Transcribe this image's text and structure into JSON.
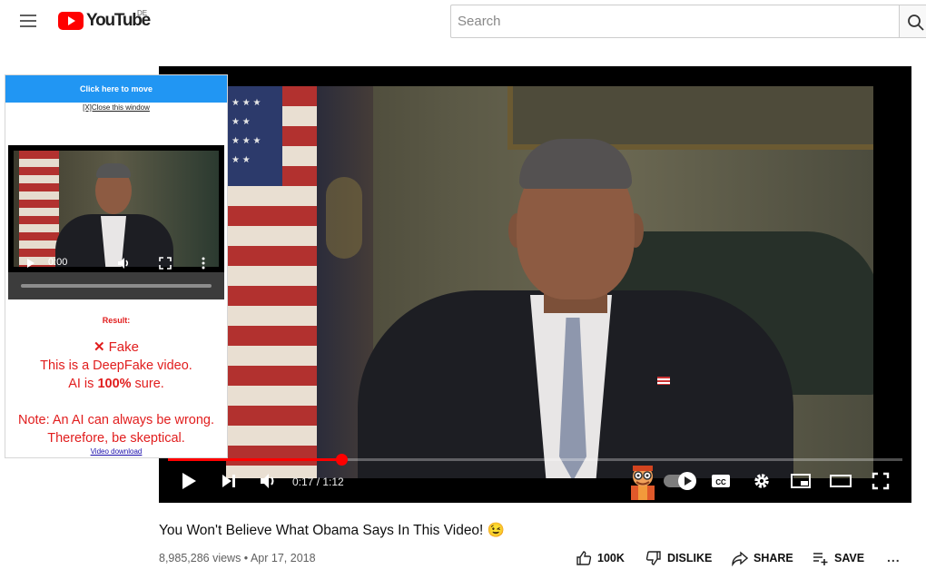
{
  "header": {
    "logo_text": "YouTube",
    "country_code": "DE",
    "search_placeholder": "Search"
  },
  "player": {
    "time_display": "0:17 / 1:12",
    "progress_fraction": 0.236
  },
  "extension_panel": {
    "move_label": "Click here to move",
    "close_label": "[X]Close this window",
    "mini_time": "0:00",
    "result_label": "Result:",
    "verdict": "Fake",
    "line1": "This is a DeepFake video.",
    "line2_prefix": "AI is ",
    "line2_bold": "100%",
    "line2_suffix": " sure.",
    "note1": "Note: An AI can always be wrong.",
    "note2": "Therefore, be skeptical.",
    "download_link": "Video download"
  },
  "video": {
    "title": "You Won't Believe What Obama Says In This Video! 😉",
    "meta": "8,985,286 views • Apr 17, 2018"
  },
  "actions": {
    "like": "100K",
    "dislike": "DISLIKE",
    "share": "SHARE",
    "save": "SAVE",
    "more": "..."
  },
  "colors": {
    "accent_red": "#ff0000",
    "panel_blue": "#2196f3",
    "verdict_red": "#e11d1d"
  }
}
